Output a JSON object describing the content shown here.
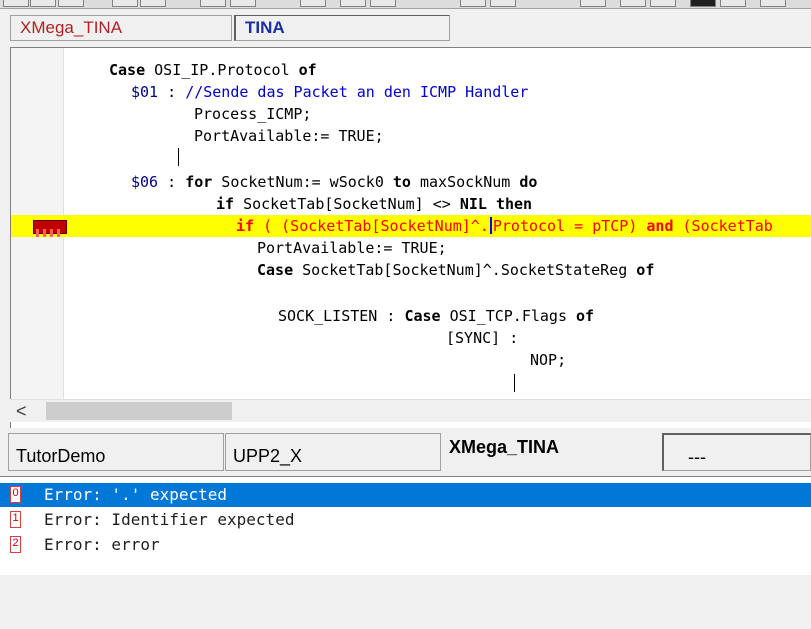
{
  "top_tabs": [
    {
      "label": "XMega_TINA",
      "active": false
    },
    {
      "label": "TINA",
      "active": true
    }
  ],
  "editor": {
    "lines": [
      {
        "id": "l1",
        "tokens": [
          {
            "t": "Case",
            "c": "kw"
          },
          {
            "t": " OSI_IP.Protocol "
          },
          {
            "t": "of",
            "c": "kw"
          }
        ]
      },
      {
        "id": "l2",
        "tokens": [
          {
            "t": "$01",
            "c": "num"
          },
          {
            "t": " : "
          },
          {
            "t": "//Sende das Packet an den ICMP Handler",
            "c": "cmt"
          }
        ]
      },
      {
        "id": "l3",
        "tokens": [
          {
            "t": "Process_ICMP;"
          }
        ]
      },
      {
        "id": "l4",
        "tokens": [
          {
            "t": "PortAvailable:= TRUE;"
          }
        ]
      },
      {
        "id": "l5",
        "tokens": []
      },
      {
        "id": "l6",
        "tokens": [
          {
            "t": "$06",
            "c": "num"
          },
          {
            "t": " : "
          },
          {
            "t": "for",
            "c": "kw"
          },
          {
            "t": " SocketNum:= wSock0 "
          },
          {
            "t": "to",
            "c": "kw"
          },
          {
            "t": " maxSockNum "
          },
          {
            "t": "do",
            "c": "kw"
          }
        ]
      },
      {
        "id": "l7",
        "tokens": [
          {
            "t": "if",
            "c": "kw"
          },
          {
            "t": " SocketTab[SocketNum] <> "
          },
          {
            "t": "NIL",
            "c": "kw"
          },
          {
            "t": " "
          },
          {
            "t": "then",
            "c": "kw"
          }
        ]
      },
      {
        "id": "l8",
        "tokens": [
          {
            "t": "if",
            "c": "kw"
          },
          {
            "t": " ( (SocketTab[SocketNum]^."
          },
          {
            "t": "",
            "c": "caret"
          },
          {
            "t": "Protocol = pTCP) "
          },
          {
            "t": "and",
            "c": "kw"
          },
          {
            "t": " (SocketTab"
          }
        ]
      },
      {
        "id": "l9",
        "tokens": [
          {
            "t": "PortAvailable:= TRUE;"
          }
        ]
      },
      {
        "id": "l10",
        "tokens": [
          {
            "t": "Case",
            "c": "kw"
          },
          {
            "t": " SocketTab[SocketNum]^.SocketStateReg "
          },
          {
            "t": "of",
            "c": "kw"
          }
        ]
      },
      {
        "id": "l11",
        "tokens": []
      },
      {
        "id": "l12",
        "tokens": [
          {
            "t": "SOCK_LISTEN : "
          },
          {
            "t": "Case",
            "c": "kw"
          },
          {
            "t": " OSI_TCP.Flags "
          },
          {
            "t": "of",
            "c": "kw"
          }
        ]
      },
      {
        "id": "l13",
        "tokens": [
          {
            "t": "[SYNC] :"
          }
        ]
      },
      {
        "id": "l14",
        "tokens": [
          {
            "t": "NOP;"
          }
        ]
      },
      {
        "id": "l15",
        "tokens": []
      }
    ]
  },
  "bottom_tabs": [
    {
      "label": "TutorDemo"
    },
    {
      "label": "UPP2_X"
    },
    {
      "label": "XMega_TINA",
      "selected": true
    },
    {
      "label": "---"
    }
  ],
  "messages": [
    {
      "num": "0",
      "text": "Error: '.' expected",
      "selected": true
    },
    {
      "num": "1",
      "text": "Error: Identifier expected",
      "selected": false
    },
    {
      "num": "2",
      "text": "Error: error",
      "selected": false
    }
  ],
  "scroll_left_arrow": "<",
  "colors": {
    "error_highlight": "#ffff00",
    "error_text": "#ff0000",
    "selection": "#0078d7",
    "comment": "#0000cc"
  }
}
